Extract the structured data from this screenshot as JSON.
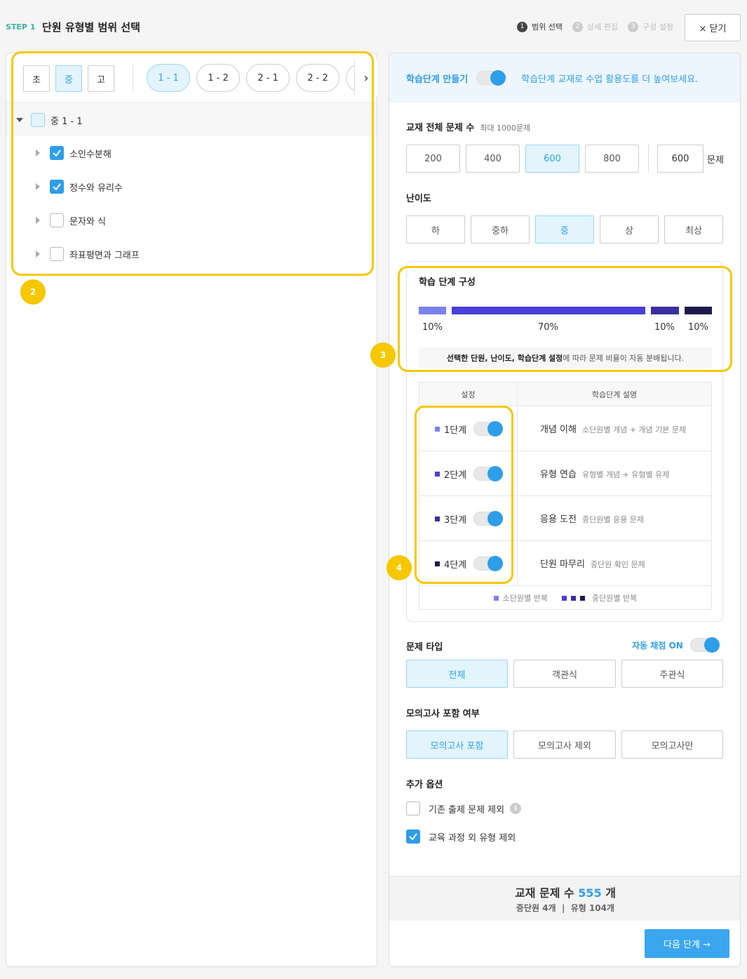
{
  "header": {
    "step": "STEP 1",
    "title": "단원 유형별 범위 선택",
    "steps": [
      {
        "num": "1",
        "label": "범위 선택"
      },
      {
        "num": "2",
        "label": "상세 편집"
      },
      {
        "num": "3",
        "label": "구성 설정"
      }
    ],
    "close_label": "× 닫기"
  },
  "left": {
    "levels": [
      "초",
      "중",
      "고"
    ],
    "grades": [
      "1 - 1",
      "1 - 2",
      "2 - 1",
      "2 - 2"
    ],
    "next_arrow": "›",
    "tree_root": "중 1 - 1",
    "units": [
      {
        "label": "소인수분해",
        "checked": true
      },
      {
        "label": "정수와 유리수",
        "checked": true
      },
      {
        "label": "문자와 식",
        "checked": false
      },
      {
        "label": "좌표평면과 그래프",
        "checked": false
      }
    ]
  },
  "right": {
    "banner": {
      "toggle_label": "학습단계 만들기",
      "desc": "학습단계 교재로 수업 활용도를 더 높여보세요."
    },
    "count": {
      "title": "교재 전체 문제 수",
      "hint": "최대 1000문제",
      "options": [
        "200",
        "400",
        "600",
        "800"
      ],
      "value": "600",
      "unit": "문제"
    },
    "difficulty": {
      "title": "난이도",
      "options": [
        "하",
        "중하",
        "중",
        "상",
        "최상"
      ]
    },
    "composition": {
      "title": "학습 단계 구성",
      "percents": [
        "10%",
        "70%",
        "10%",
        "10%"
      ],
      "note_bold": "선택한 단원, 난이도, 학습단계 설정",
      "note_rest": "에 따라 문제 비율이 자동 분배됩니다."
    },
    "table": {
      "col1": "설정",
      "col2": "학습단계 설명",
      "rows": [
        {
          "stage": "1단계",
          "name": "개념 이해",
          "desc": "소단원별 개념 + 개념 기본 문제"
        },
        {
          "stage": "2단계",
          "name": "유형 연습",
          "desc": "유형별 개념 + 유형별 유제"
        },
        {
          "stage": "3단계",
          "name": "응용 도전",
          "desc": "중단원별 응용 문제"
        },
        {
          "stage": "4단계",
          "name": "단원 마무리",
          "desc": "중단원 확인 문제"
        }
      ],
      "legend1": "소단원별 반복",
      "legend2": "중단원별 반복"
    },
    "type": {
      "title": "문제 타입",
      "auto_label": "자동 채점 ON",
      "options": [
        "전체",
        "객관식",
        "주관식"
      ]
    },
    "mock": {
      "title": "모의고사 포함 여부",
      "options": [
        "모의고사 포함",
        "모의고사 제외",
        "모의고사만"
      ]
    },
    "extra": {
      "title": "추가 옵션",
      "opt1": "기존 출제 문제 제외",
      "opt2": "교육 과정 외 유형 제외"
    },
    "footer": {
      "prefix": "교재 문제 수",
      "count": "555",
      "suffix": "개",
      "sub": "중단원 4개  |  유형 104개",
      "next_label": "다음 단계 →"
    }
  },
  "annotations": [
    "2",
    "3",
    "4"
  ],
  "colors": {
    "accent": "#2e9ee8",
    "stage1": "#7b82ee",
    "stage2": "#4a3fd8",
    "stage3": "#3a2fa0",
    "stage4": "#1e1a4a",
    "highlight": "#f5c800"
  }
}
